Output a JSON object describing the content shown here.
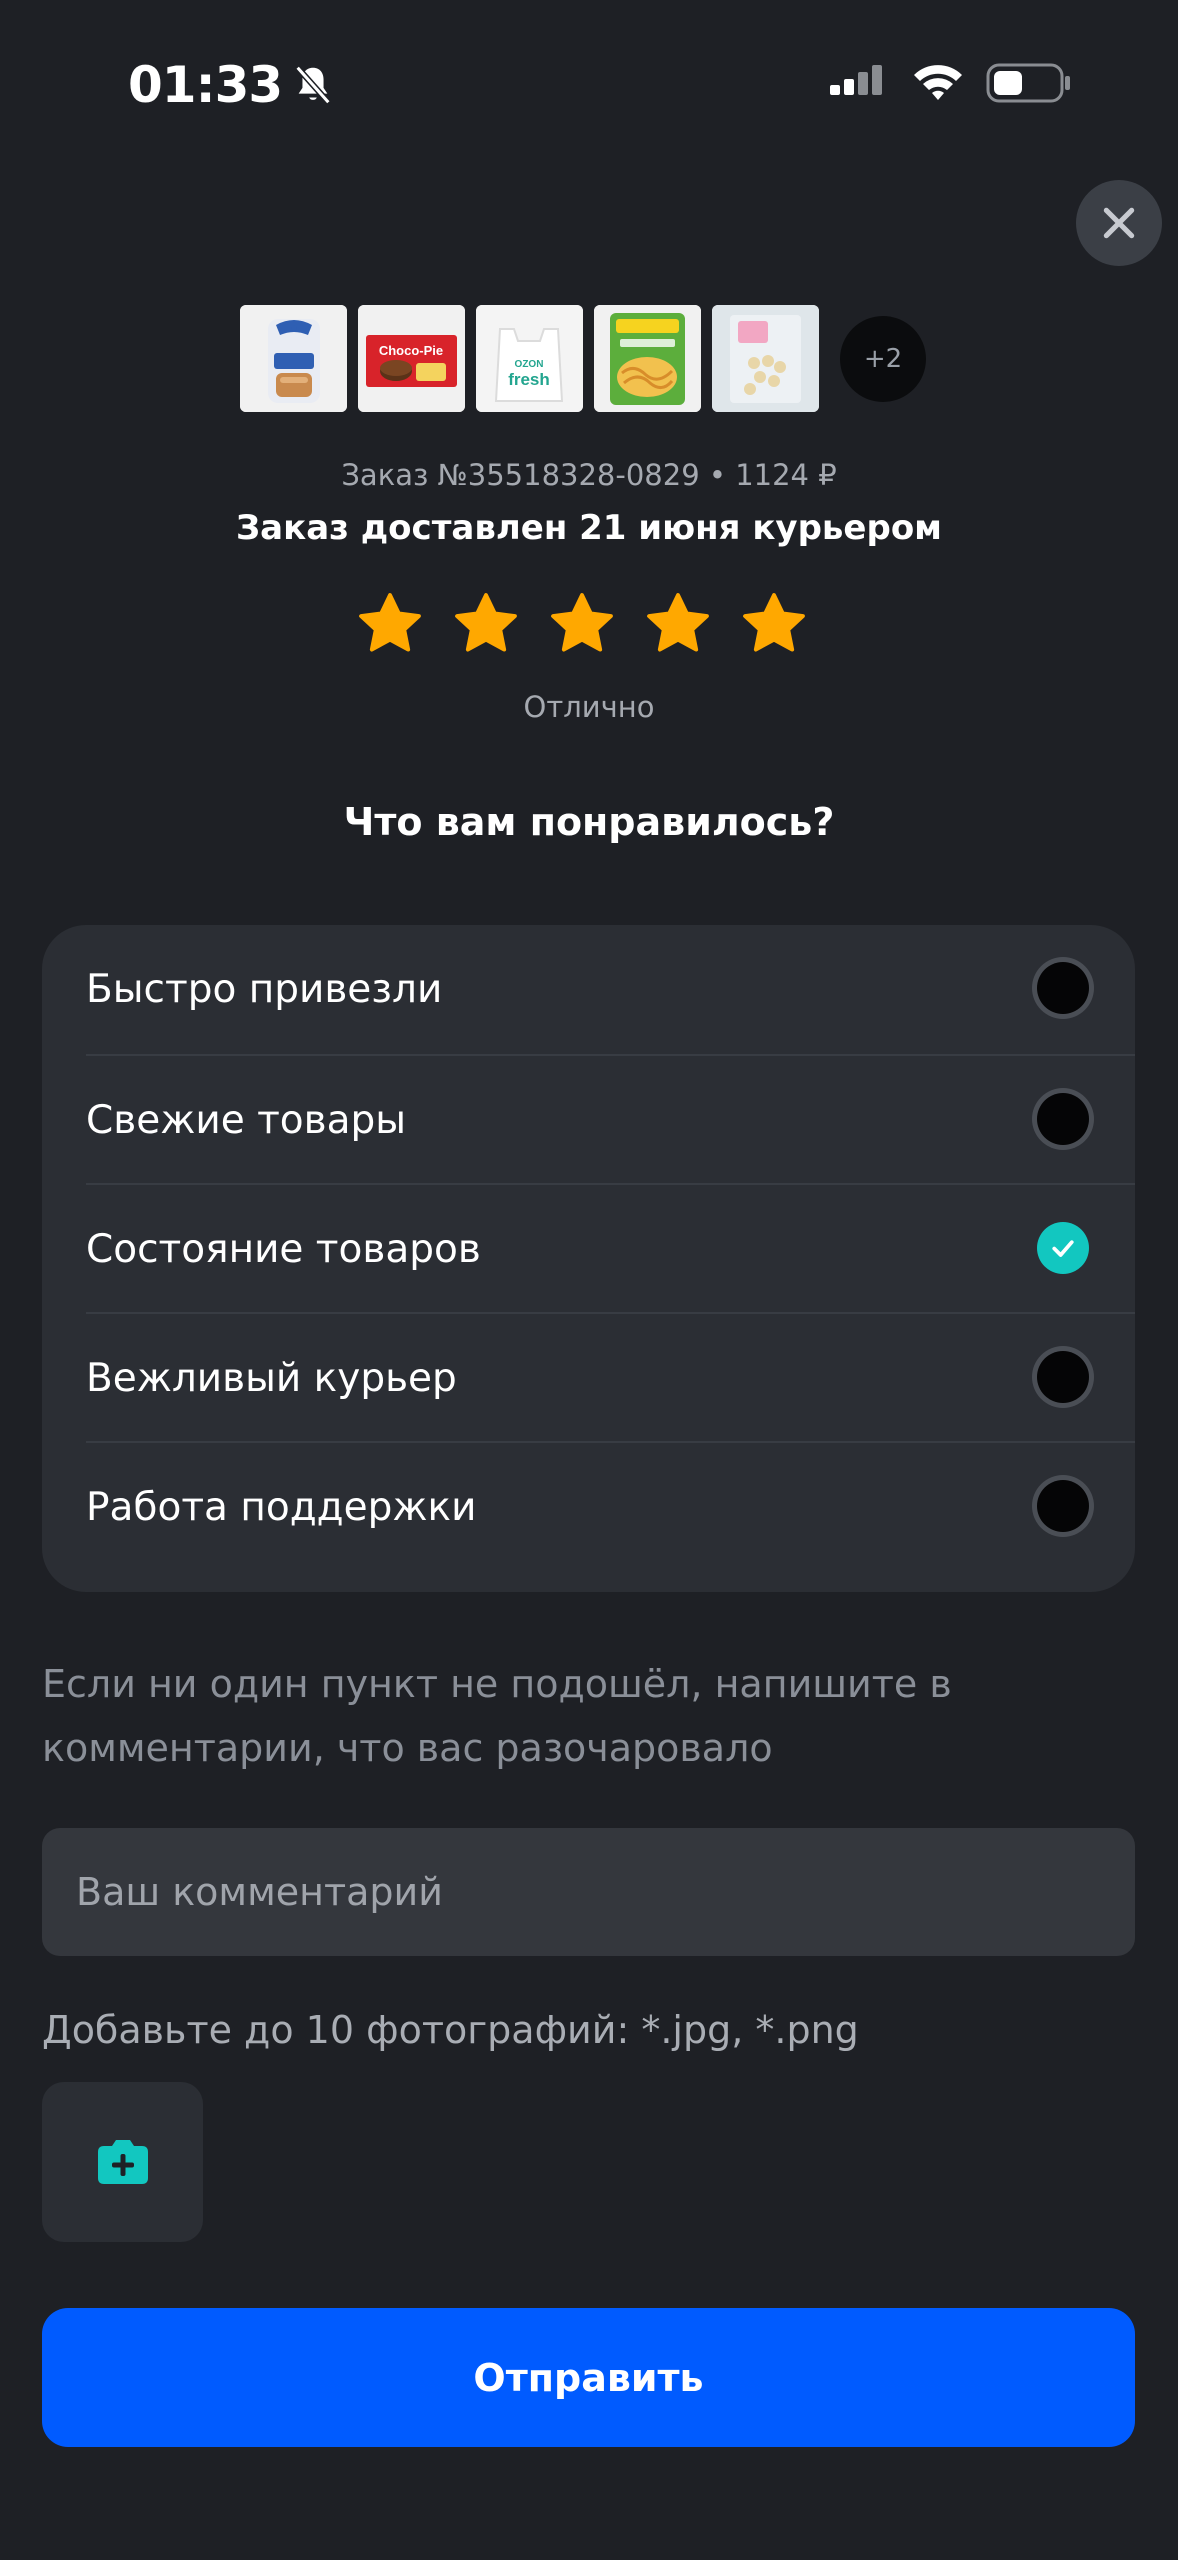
{
  "status_bar": {
    "time": "01:33",
    "icons": [
      "bell-slash-icon",
      "cellular-icon",
      "wifi-icon",
      "battery-icon"
    ]
  },
  "order": {
    "more_count": "+2",
    "meta": "Заказ №35518328-0829 • 1124 ₽",
    "title": "Заказ доставлен 21 июня курьером",
    "rating_value": 5,
    "rating_max": 5,
    "rating_text": "Отлично",
    "products": [
      "bread",
      "Choco-Pie",
      "ozon fresh bag",
      "noodles",
      "pack"
    ],
    "thumb_labels": {
      "chocopie": "Choco-Pie",
      "bag_top": "OZON",
      "bag_bottom": "fresh"
    }
  },
  "feedback": {
    "question": "Что вам понравилось?",
    "options": [
      {
        "label": "Быстро привезли",
        "checked": false
      },
      {
        "label": "Свежие товары",
        "checked": false
      },
      {
        "label": "Состояние товаров",
        "checked": true
      },
      {
        "label": "Вежливый курьер",
        "checked": false
      },
      {
        "label": "Работа поддержки",
        "checked": false
      }
    ],
    "hint": "Если ни один пункт не подошёл, напишите в комментарии, что вас разочаровало",
    "comment_placeholder": "Ваш комментарий",
    "comment_value": "",
    "photos_label": "Добавьте до 10 фотографий: *.jpg, *.png",
    "submit_label": "Отправить"
  },
  "colors": {
    "background": "#1e2025",
    "card": "#2b2e34",
    "star": "#ffa800",
    "accent_teal": "#12c7c0",
    "primary_button": "#005bff"
  }
}
